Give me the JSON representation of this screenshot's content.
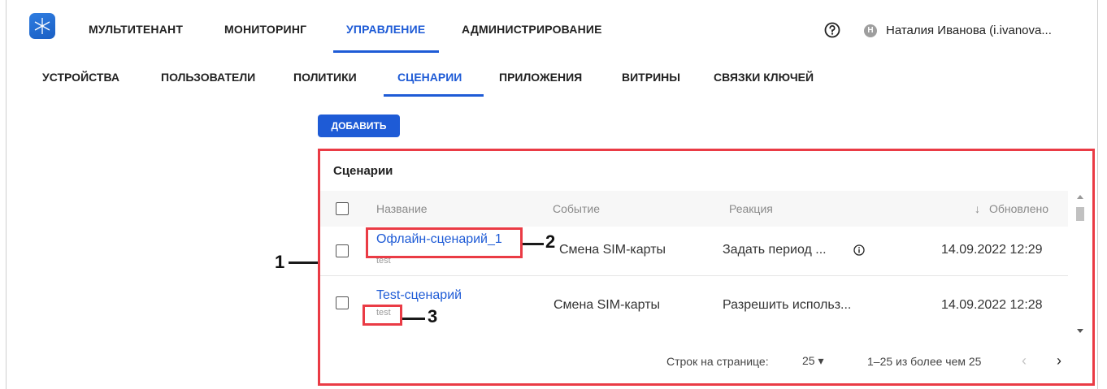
{
  "top_nav": {
    "items": [
      "МУЛЬТИТЕНАНТ",
      "МОНИТОРИНГ",
      "УПРАВЛЕНИЕ",
      "АДМИНИСТРИРОВАНИЕ"
    ],
    "active": "УПРАВЛЕНИЕ"
  },
  "user": {
    "avatar_letter": "Н",
    "name": "Наталия Иванова (i.ivanova..."
  },
  "sub_nav": {
    "items": [
      "УСТРОЙСТВА",
      "ПОЛЬЗОВАТЕЛИ",
      "ПОЛИТИКИ",
      "СЦЕНАРИИ",
      "ПРИЛОЖЕНИЯ",
      "ВИТРИНЫ",
      "СВЯЗКИ КЛЮЧЕЙ"
    ],
    "active": "СЦЕНАРИИ"
  },
  "toolbar": {
    "add_label": "ДОБАВИТЬ"
  },
  "table": {
    "title": "Сценарии",
    "columns": [
      "Название",
      "Событие",
      "Реакция",
      "Обновлено"
    ],
    "sort_column": "Обновлено",
    "rows": [
      {
        "name": "Офлайн-сценарий_1",
        "description": "test",
        "event": "Смена SIM-карты",
        "reaction": "Задать период ...",
        "updated": "14.09.2022 12:29"
      },
      {
        "name": "Test-сценарий",
        "description": "test",
        "event": "Смена SIM-карты",
        "reaction": "Разрешить использ...",
        "updated": "14.09.2022 12:28"
      }
    ],
    "footer": {
      "rows_per_page_label": "Строк на странице:",
      "rows_per_page_value": "25",
      "range": "1–25 из более чем 25"
    }
  },
  "annotations": [
    "1",
    "2",
    "3"
  ],
  "colors": {
    "accent": "#1e5bd6",
    "annotation": "#ea3b45"
  }
}
